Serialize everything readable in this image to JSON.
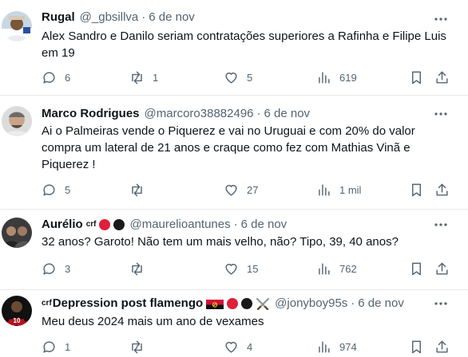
{
  "tweets": [
    {
      "name": "Rugal",
      "handle": "@_gbsillva",
      "separator": "·",
      "date": "6 de nov",
      "text": "Alex Sandro e Danilo seriam contratações superiores a Rafinha e Filipe Luis em 19",
      "replies": "6",
      "retweets": "1",
      "likes": "5",
      "views": "619"
    },
    {
      "name": "Marco Rodrigues",
      "handle": "@marcoro38882496",
      "separator": "·",
      "date": "6 de nov",
      "text": "Ai o Palmeiras vende o Piquerez e vai no Uruguai e com 20% do valor compra um lateral de 21 anos e craque como fez com Mathias Vinã e Piquerez !",
      "replies": "5",
      "retweets": "",
      "likes": "27",
      "views": "1 mil"
    },
    {
      "name": "Aurélio",
      "name_sup": "crf",
      "handle": "@maurelioantunes",
      "separator": "·",
      "date": "6 de nov",
      "text": "32 anos? Garoto! Não tem um mais velho, não? Tipo, 39, 40 anos?",
      "replies": "3",
      "retweets": "",
      "likes": "15",
      "views": "762"
    },
    {
      "name_sup": "crf",
      "name": "Depression post flamengo",
      "handle": "@jonyboy95s",
      "separator": "·",
      "date": "6 de nov",
      "text": "Meu deus 2024 mais um ano de vexames",
      "replies": "1",
      "retweets": "",
      "likes": "4",
      "views": "974"
    }
  ],
  "colors": {
    "text": "#0f1419",
    "muted": "#536471",
    "divider": "#e7e9ea",
    "badge_red": "#e0203a",
    "badge_black": "#1a1a1a",
    "flag_red": "#d21034",
    "flag_black": "#111111"
  },
  "icons": [
    "reply-icon",
    "retweet-icon",
    "like-icon",
    "views-icon",
    "bookmark-icon",
    "share-icon",
    "more-icon",
    "swords-emoji-icon",
    "angola-flag-icon"
  ]
}
